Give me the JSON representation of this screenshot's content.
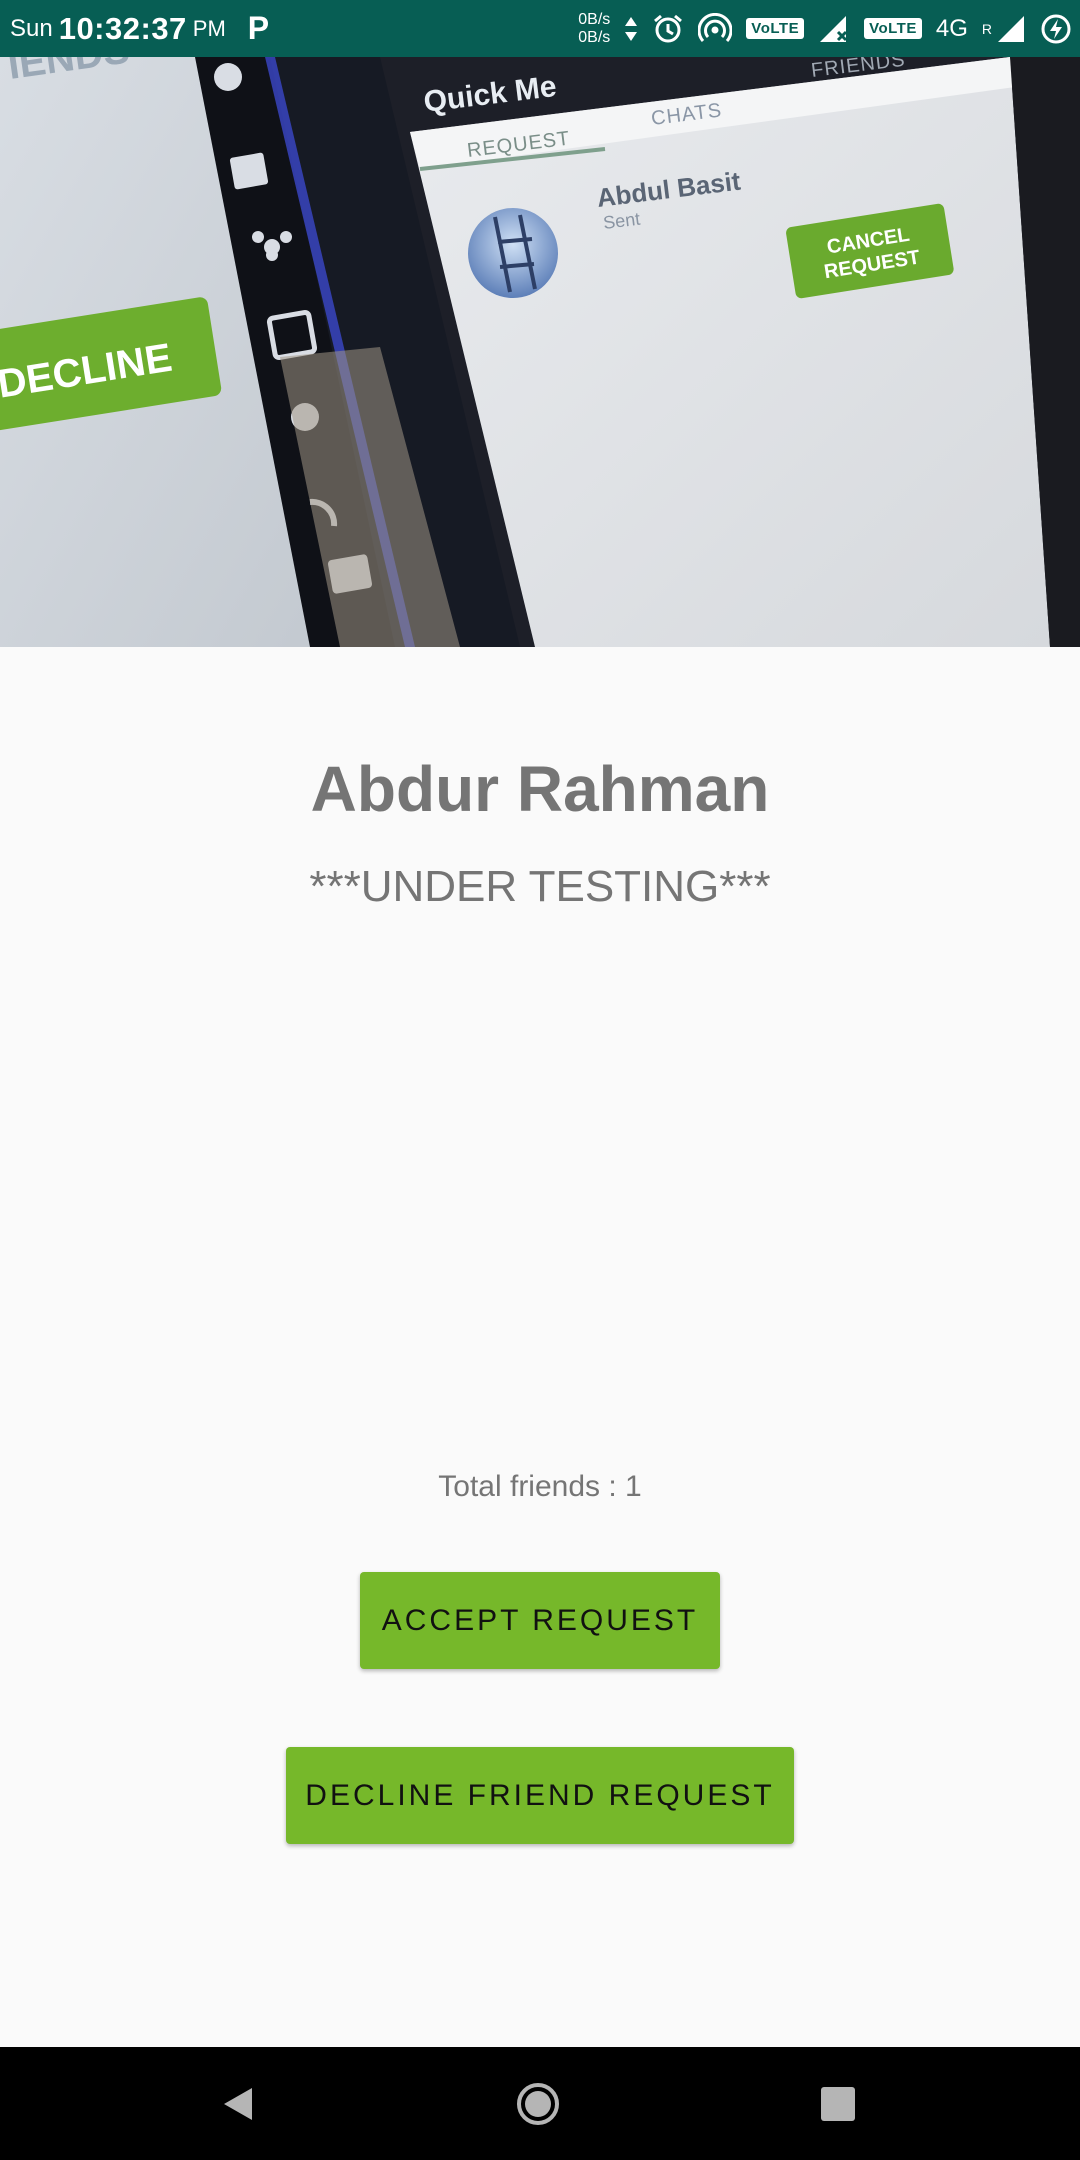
{
  "status_bar": {
    "day": "Sun",
    "time": "10:32:37",
    "ampm": "PM",
    "p_badge": "P",
    "speed_up": "0B/s",
    "speed_down": "0B/s",
    "volte1": "VoLTE",
    "volte2": "VoLTE",
    "network": "4G",
    "roaming": "R"
  },
  "photo": {
    "left_button": "DECLINE",
    "left_heading": "IENDS",
    "app_title": "Quick Me",
    "tab_request": "REQUEST",
    "tab_chats": "CHATS",
    "tab_friends": "FRIENDS",
    "contact_name": "Abdul Basit",
    "contact_status": "Sent",
    "cancel_line1": "CANCEL",
    "cancel_line2": "REQUEST"
  },
  "profile": {
    "name": "Abdur Rahman",
    "status": "***UNDER TESTING***",
    "friends_count": "Total friends : 1"
  },
  "actions": {
    "accept_label": "ACCEPT REQUEST",
    "decline_label": "DECLINE FRIEND REQUEST"
  },
  "colors": {
    "status_bar": "#075e54",
    "accent_green": "#76b82a",
    "text_gray": "#757575"
  }
}
